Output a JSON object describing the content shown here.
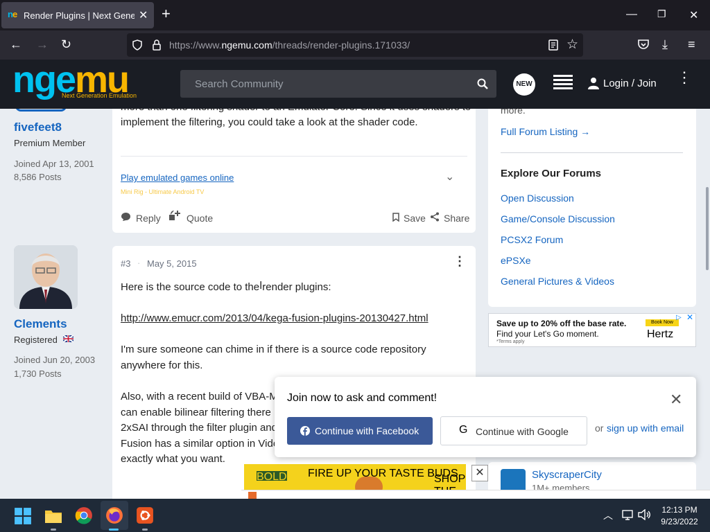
{
  "browser": {
    "tab_title": "Render Plugins | Next Generatio",
    "url_prefix": "https://www.",
    "url_domain": "ngemu.com",
    "url_path": "/threads/render-plugins.171033/"
  },
  "site": {
    "logo_left": "nge",
    "logo_right": "mu",
    "tagline": "Next Generation Emulation",
    "search_placeholder": "Search Community",
    "new_badge": "NEW",
    "login_label": "Login / Join"
  },
  "posts": [
    {
      "author": "fivefeet8",
      "role": "Premium Member",
      "joined": "Joined Apr 13, 2001",
      "posts": "8,586 Posts",
      "text_partial": "more than one filtering shader to an Emulator Core. Since it uses shaders to",
      "text_line2": "implement the filtering, you could take a look at the shader code.",
      "ad_link": "Play emulated games online",
      "ad_sub": "Mini Rig - Ultimate Android TV",
      "actions": {
        "reply": "Reply",
        "quote": "Quote",
        "save": "Save",
        "share": "Share"
      }
    },
    {
      "number": "#3",
      "date": "May 5, 2015",
      "author": "Clements",
      "role": "Registered",
      "joined": "Joined Jun 20, 2003",
      "posts": "1,730 Posts",
      "p1": "Here is the source code to the render plugins:",
      "link": "http://www.emucr.com/2013/04/kega-fusion-plugins-20130427.html",
      "p2a": "I'm sure someone can chime in if there is a source code repository",
      "p2b": "anywhere for this.",
      "p3a": "Also, with a recent build of VBA-M",
      "p3b": "can enable bilinear filtering there",
      "p3c": "2xSAI through the filter plugin and",
      "p3d": "Fusion has a similar option in Vide",
      "p3e": "exactly what you want."
    }
  ],
  "sidebar": {
    "more_text": "more.",
    "full_listing": "Full Forum Listing",
    "explore_title": "Explore Our Forums",
    "forums": [
      "Open Discussion",
      "Game/Console Discussion",
      "PCSX2 Forum",
      "ePSXe",
      "General Pictures & Videos"
    ],
    "ad_title": "Save up to 20% off the base rate.",
    "ad_sub": "Find your Let's Go moment.",
    "ad_terms": "*Terms apply",
    "ad_brand": "Hertz",
    "ad_book": "Book Now",
    "community_name": "SkyscraperCity",
    "community_members": "1M+ members"
  },
  "popup": {
    "title": "Join now to ask and comment!",
    "facebook": "Continue with Facebook",
    "google": "Continue with Google",
    "or": "or",
    "signup": "sign up with email"
  },
  "ad_bottom": {
    "text": "FIRE UP YOUR TASTE BUDS.",
    "cta": "SHOP THE BITES",
    "brand": "BOLD ONES"
  },
  "taskbar": {
    "time": "12:13 PM",
    "date": "9/23/2022"
  }
}
